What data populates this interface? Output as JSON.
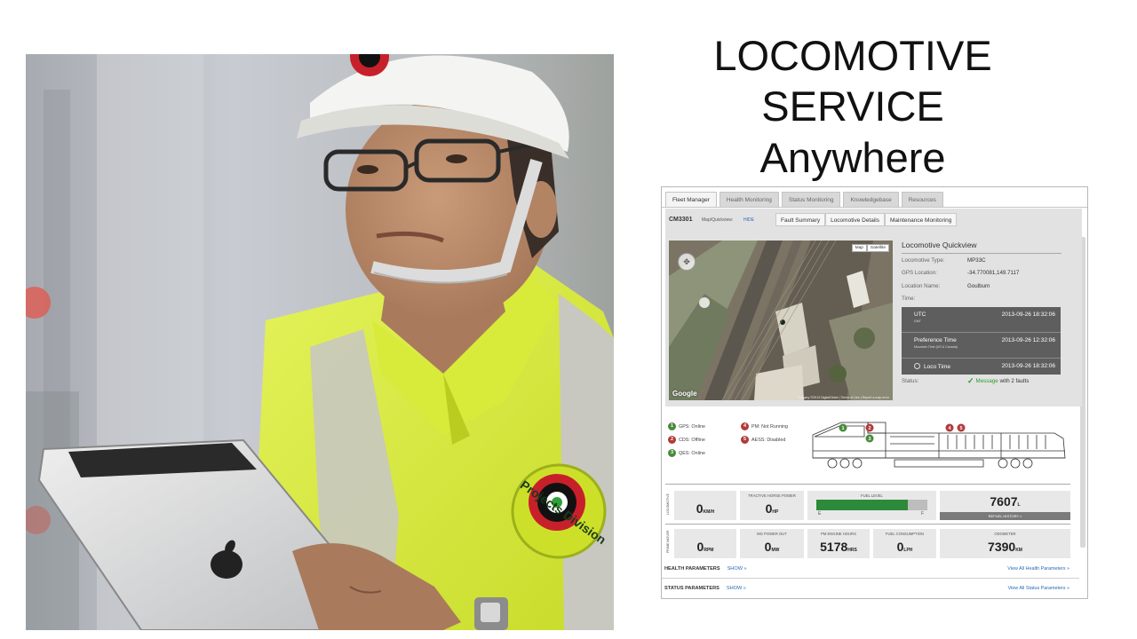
{
  "slide": {
    "title_line1": "LOCOMOTIVE SERVICE",
    "title_line2": "Anywhere",
    "badge_text": "Projects Division",
    "colors": {
      "vest": "#dff03a",
      "reflective": "#c8c8c0",
      "badge_red": "#c8202a"
    }
  },
  "dashboard": {
    "tabs": [
      "Fleet Manager",
      "Health Monitoring",
      "Status Monitoring",
      "Knowledgebase",
      "Resources"
    ],
    "active_tab": "Fleet Manager",
    "unit_id": "CM3301",
    "map_label": "Map/Quickview:",
    "hide_link": "HIDE",
    "sub_tabs": [
      "Fault Summary",
      "Locomotive Details",
      "Maintenance Monitoring"
    ],
    "map": {
      "btn_map": "Map",
      "btn_satellite": "Satellite",
      "google": "Google",
      "copyright": "Imagery ©2013 DigitalGlobe | Terms of Use | Report a map error"
    },
    "quickview": {
      "title": "Locomotive Quickview",
      "rows": [
        {
          "k": "Locomotive Type:",
          "v": "MP33C"
        },
        {
          "k": "GPS Location:",
          "v": "-34.770081,149.7117"
        },
        {
          "k": "Location Name:",
          "v": "Goulburn"
        },
        {
          "k": "Time:",
          "v": ""
        }
      ],
      "times": [
        {
          "label": "UTC",
          "sub": "GMT",
          "value": "2013-09-26 18:32:06"
        },
        {
          "label": "Preference Time",
          "sub": "Mountain Time (US & Canada)",
          "value": "2013-09-26 12:32:06"
        },
        {
          "label": "Loco Time",
          "sub": "",
          "value": "2013-09-26 18:32:06"
        }
      ],
      "status_label": "Status:",
      "status_msg": "Message",
      "status_rest": "with 2 faults"
    },
    "legend": [
      {
        "n": "1",
        "text": "GPS: Online",
        "color": "g"
      },
      {
        "n": "2",
        "text": "CDS: Offline",
        "color": "r"
      },
      {
        "n": "3",
        "text": "QES: Online",
        "color": "g"
      },
      {
        "n": "4",
        "text": "PM: Not Running",
        "color": "r"
      },
      {
        "n": "5",
        "text": "AESS: Disabled",
        "color": "r"
      }
    ],
    "section_locomotive": "LOCOMOTIVE",
    "section_prime_mover": "PRIME MOVER",
    "speed": {
      "value": "0",
      "unit": "KM/H"
    },
    "tractive": {
      "caption": "TRACTIVE HORSE POWER",
      "value": "0",
      "unit": "HP"
    },
    "fuel": {
      "caption": "FUEL LEVEL",
      "level_pct": 82,
      "e": "E",
      "f": "F"
    },
    "fuel_amount": {
      "value": "7607",
      "unit": "L",
      "refuel": "REFUEL HISTORY »"
    },
    "rpm": {
      "value": "0",
      "unit": "RPM"
    },
    "mg_power": {
      "caption": "MG POWER OUT",
      "value": "0",
      "unit": "MW"
    },
    "engine_hours": {
      "caption": "PM ENGINE HOURS",
      "value": "5178",
      "unit": "HRS"
    },
    "fuel_consumption": {
      "caption": "FUEL CONSUMPTION",
      "value": "0",
      "unit": "LPH"
    },
    "odometer": {
      "caption": "ODOMETER",
      "value": "7390",
      "unit": "KM"
    },
    "health": {
      "label": "HEALTH PARAMETERS",
      "show": "SHOW »",
      "link": "View All Health Parameters »"
    },
    "status_params": {
      "label": "STATUS PARAMETERS",
      "show": "SHOW »",
      "link": "View All Status Parameters »"
    }
  }
}
